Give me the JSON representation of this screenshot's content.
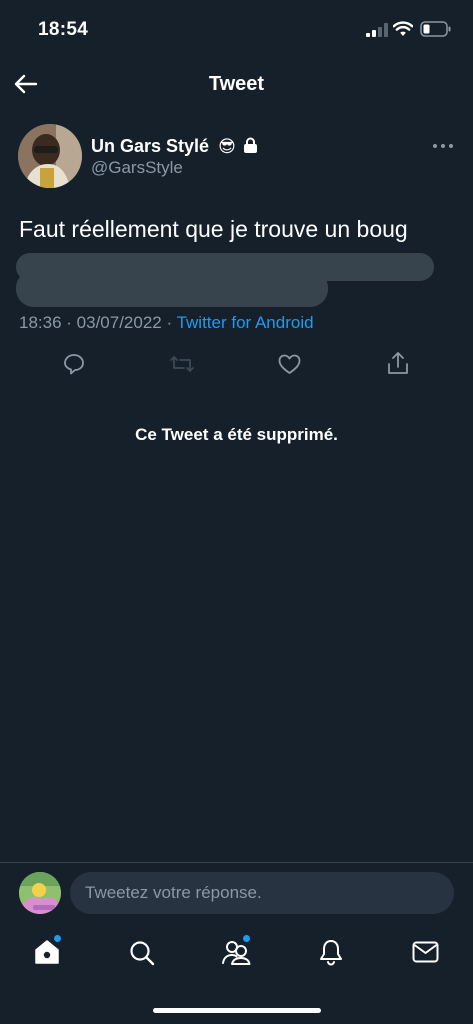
{
  "status_bar": {
    "time": "18:54"
  },
  "nav": {
    "title": "Tweet"
  },
  "tweet": {
    "display_name": "Un Gars Stylé",
    "name_emoji": "😎",
    "handle": "@GarsStyle",
    "text": "Faut réellement que je trouve un boug",
    "time": "18:36",
    "date": "03/07/2022",
    "separator": " · ",
    "source": "Twitter for Android"
  },
  "notice": {
    "deleted": "Ce Tweet a été supprimé."
  },
  "composer": {
    "placeholder": "Tweetez votre réponse."
  },
  "icons": {
    "back": "arrow-left-icon",
    "more": "more-horizontal-icon",
    "lock": "lock-icon",
    "actions": [
      "reply-icon",
      "retweet-icon",
      "like-icon",
      "share-icon"
    ],
    "tabs": [
      "home-icon",
      "search-icon",
      "communities-icon",
      "notifications-icon",
      "messages-icon"
    ]
  },
  "colors": {
    "background": "#15202b",
    "accent": "#1d9bf0",
    "secondary_text": "#8b98a5",
    "divider": "#38444d"
  }
}
